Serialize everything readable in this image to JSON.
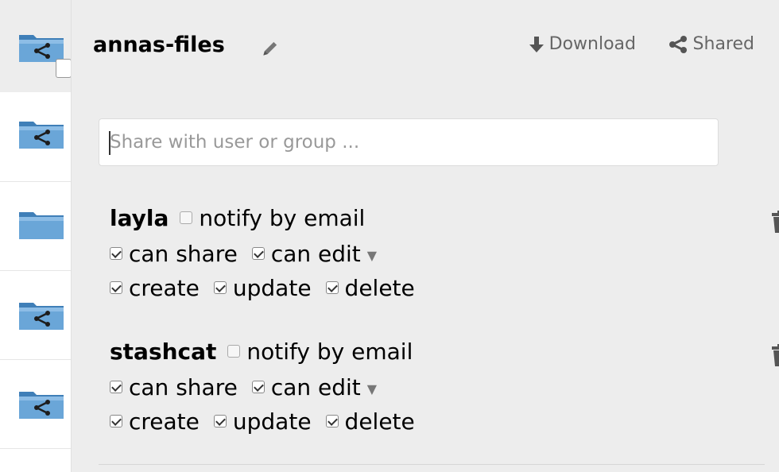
{
  "file_list": {
    "items": [
      {
        "icon": "shared-folder-icon",
        "selected": true
      },
      {
        "icon": "shared-folder-icon",
        "selected": false
      },
      {
        "icon": "folder-icon",
        "selected": false
      },
      {
        "icon": "shared-folder-icon",
        "selected": false
      },
      {
        "icon": "shared-folder-icon",
        "selected": false
      }
    ]
  },
  "sidebar": {
    "title": "annas-files",
    "actions": {
      "download_label": "Download",
      "shared_label": "Shared"
    },
    "share_input": {
      "placeholder": "Share with user or group ...",
      "value": ""
    },
    "shares": [
      {
        "user": "layla",
        "notify_label": "notify by email",
        "notify_checked": false,
        "can_share_label": "can share",
        "can_share_checked": true,
        "can_edit_label": "can edit",
        "can_edit_checked": true,
        "create_label": "create",
        "create_checked": true,
        "update_label": "update",
        "update_checked": true,
        "delete_label": "delete",
        "delete_checked": true
      },
      {
        "user": "stashcat",
        "notify_label": "notify by email",
        "notify_checked": false,
        "can_share_label": "can share",
        "can_share_checked": true,
        "can_edit_label": "can edit",
        "can_edit_checked": true,
        "create_label": "create",
        "create_checked": true,
        "update_label": "update",
        "update_checked": true,
        "delete_label": "delete",
        "delete_checked": true
      }
    ]
  },
  "colors": {
    "folder_blue": "#5d9bd1",
    "sidebar_bg": "#ededed",
    "muted_text": "#666666"
  }
}
